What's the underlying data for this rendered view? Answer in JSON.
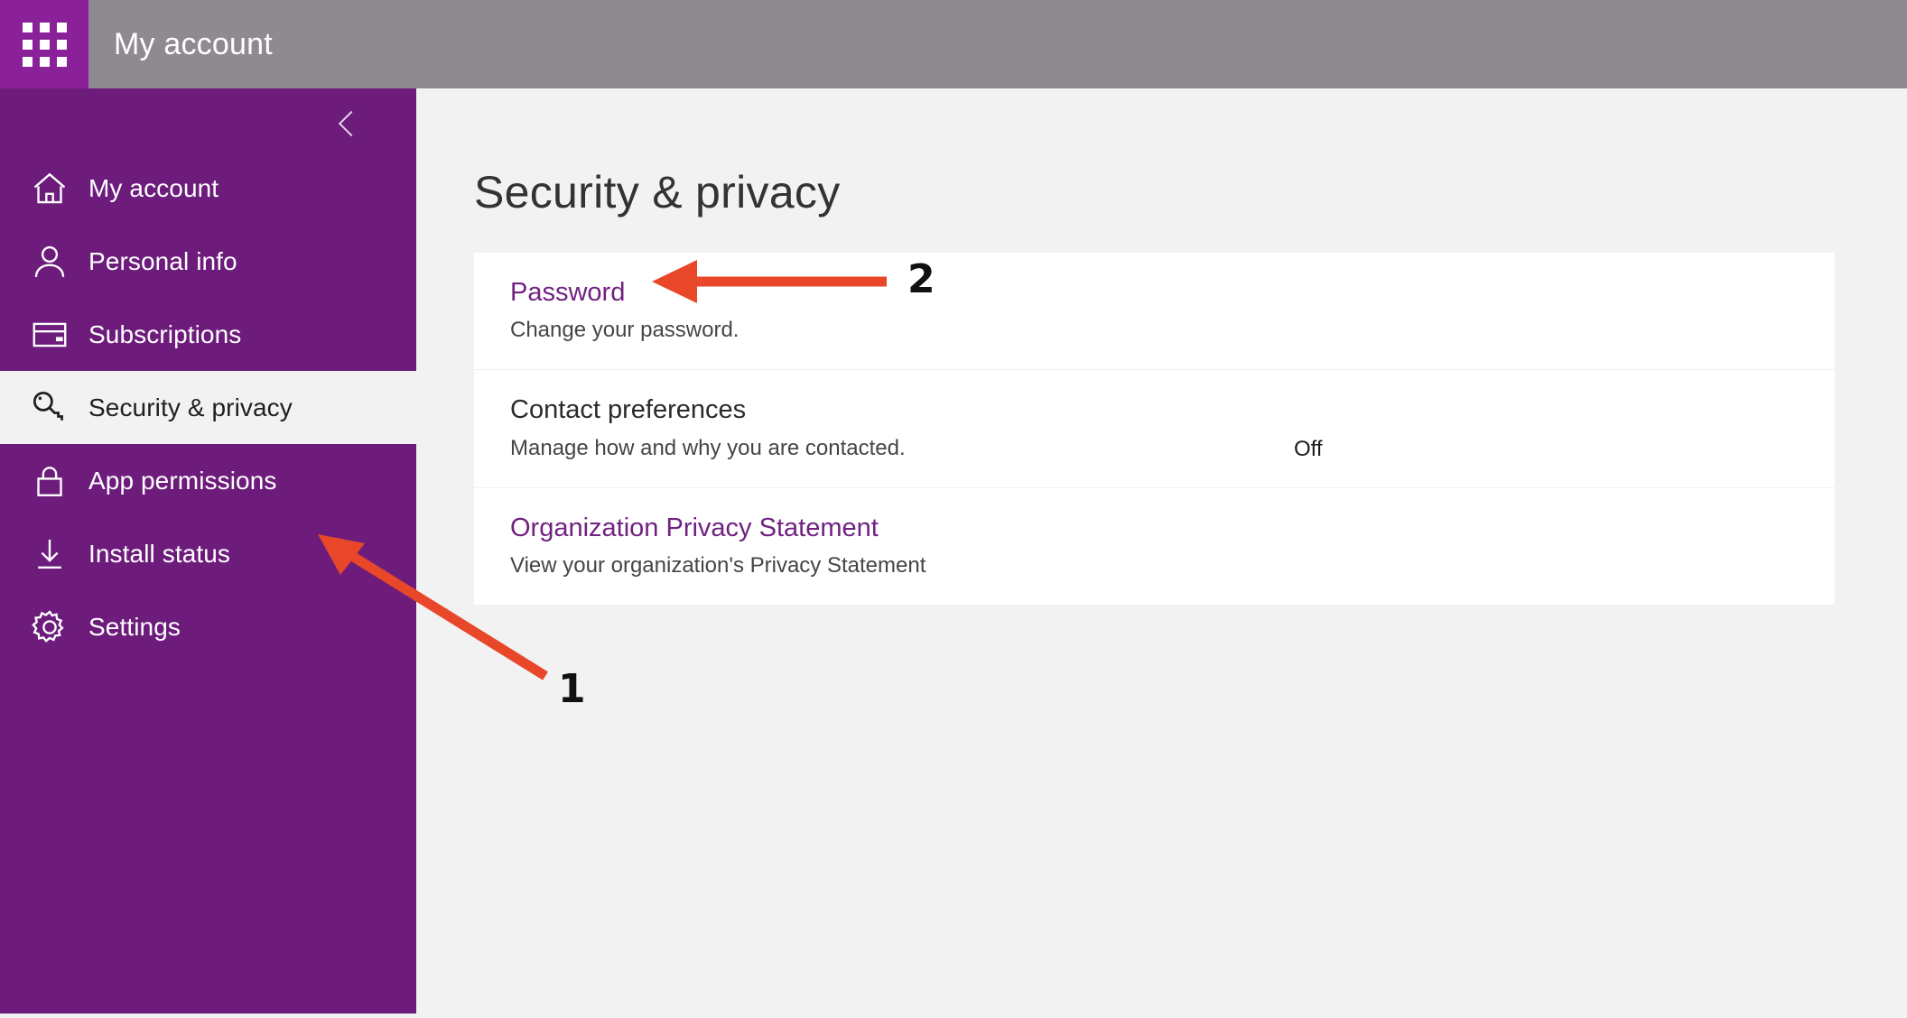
{
  "topbar": {
    "waffle_icon": "app-launcher-waffle-icon",
    "title": "My account"
  },
  "sidebar": {
    "collapse_icon": "chevron-left-icon",
    "items": [
      {
        "label": "My account",
        "icon": "home-icon",
        "active": false
      },
      {
        "label": "Personal info",
        "icon": "person-icon",
        "active": false
      },
      {
        "label": "Subscriptions",
        "icon": "card-icon",
        "active": false
      },
      {
        "label": "Security & privacy",
        "icon": "key-icon",
        "active": true
      },
      {
        "label": "App permissions",
        "icon": "lock-icon",
        "active": false
      },
      {
        "label": "Install status",
        "icon": "download-icon",
        "active": false
      },
      {
        "label": "Settings",
        "icon": "gear-icon",
        "active": false
      }
    ]
  },
  "main": {
    "page_title": "Security & privacy",
    "cards": [
      {
        "title": "Password",
        "title_is_link": true,
        "description": "Change your password.",
        "status": ""
      },
      {
        "title": "Contact preferences",
        "title_is_link": false,
        "description": "Manage how and why you are contacted.",
        "status": "Off"
      },
      {
        "title": "Organization Privacy Statement",
        "title_is_link": true,
        "description": "View your organization's Privacy Statement",
        "status": ""
      }
    ]
  },
  "annotations": {
    "color": "#e8472a",
    "items": [
      {
        "label": "1",
        "target": "sidebar-item-security-privacy"
      },
      {
        "label": "2",
        "target": "card-title-password"
      }
    ]
  },
  "colors": {
    "sidebar_purple": "#6d1c7c",
    "waffle_purple": "#8a2199",
    "header_gray": "#8e8a90",
    "page_bg": "#f2f2f2",
    "card_bg": "#ffffff",
    "link_purple": "#702181",
    "annotation_red": "#e8472a"
  }
}
